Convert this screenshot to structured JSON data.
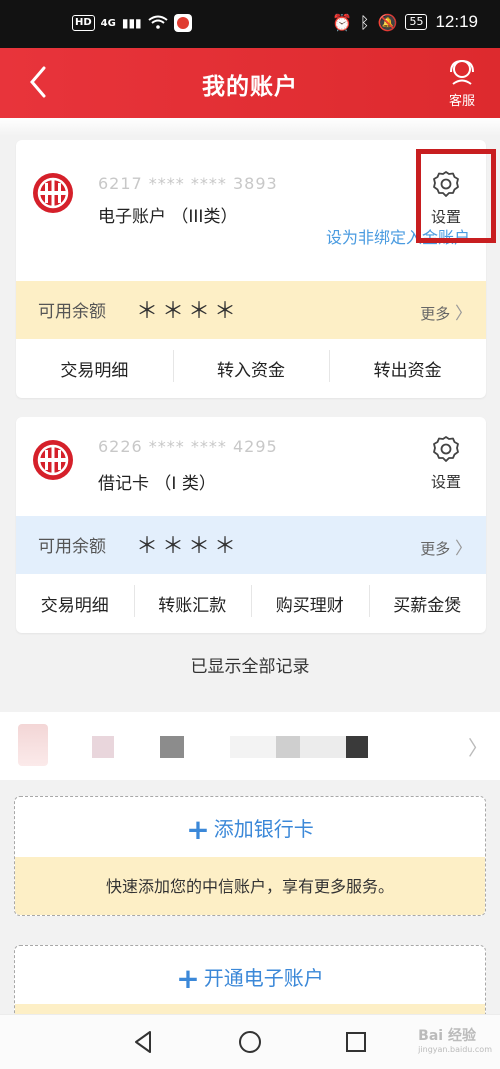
{
  "status_bar": {
    "left_badges": [
      "HD",
      "4G"
    ],
    "battery": "55",
    "time": "12:19"
  },
  "header": {
    "title": "我的账户",
    "service_label": "客服"
  },
  "accounts": [
    {
      "account_number": "6217 **** **** 3893",
      "type": "电子账户 （III类）",
      "settings_label": "设置",
      "link": "设为非绑定入金账户",
      "balance_label": "可用余额",
      "balance": "＊＊＊＊",
      "more": "更多",
      "actions": [
        "交易明细",
        "转入资金",
        "转出资金"
      ]
    },
    {
      "account_number": "6226 **** **** 4295",
      "type": "借记卡 （I 类）",
      "settings_label": "设置",
      "balance_label": "可用余额",
      "balance": "＊＊＊＊",
      "more": "更多",
      "actions": [
        "交易明细",
        "转账汇款",
        "购买理财",
        "买薪金煲"
      ]
    }
  ],
  "all_records": "已显示全部记录",
  "add_bank_card": {
    "label": "添加银行卡",
    "tip": "快速添加您的中信账户，享有更多服务。"
  },
  "open_e_account": {
    "label": "开通电子账户"
  },
  "watermark": {
    "text": "Bai 经验",
    "sub": "jingyan.baidu.com"
  },
  "colors": {
    "header_red": "#e03a3c",
    "highlight_box": "#c81e20",
    "link_blue": "#4a9be0",
    "balance_yellow": "#fdefc6",
    "balance_blue": "#e3effc"
  }
}
